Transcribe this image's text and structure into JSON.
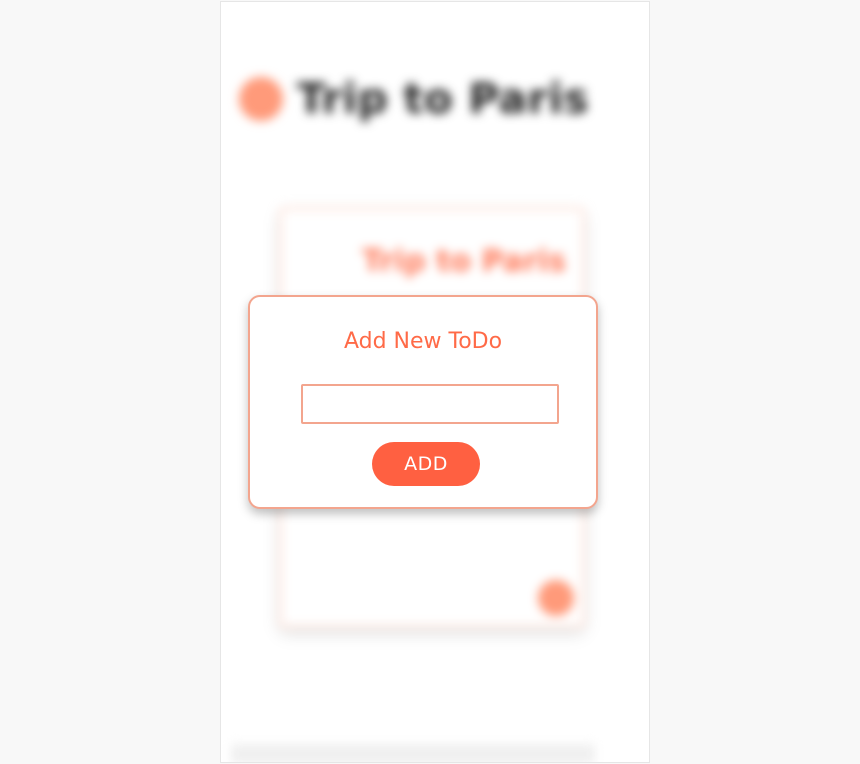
{
  "background": {
    "title": "Trip to Paris",
    "card_title": "Trip to Paris"
  },
  "modal": {
    "title": "Add New ToDo",
    "input_value": "",
    "input_placeholder": "",
    "add_label": "ADD"
  },
  "colors": {
    "accent": "#ff6041",
    "accent_light": "#f3a58e",
    "title_text": "#ff6a47"
  }
}
